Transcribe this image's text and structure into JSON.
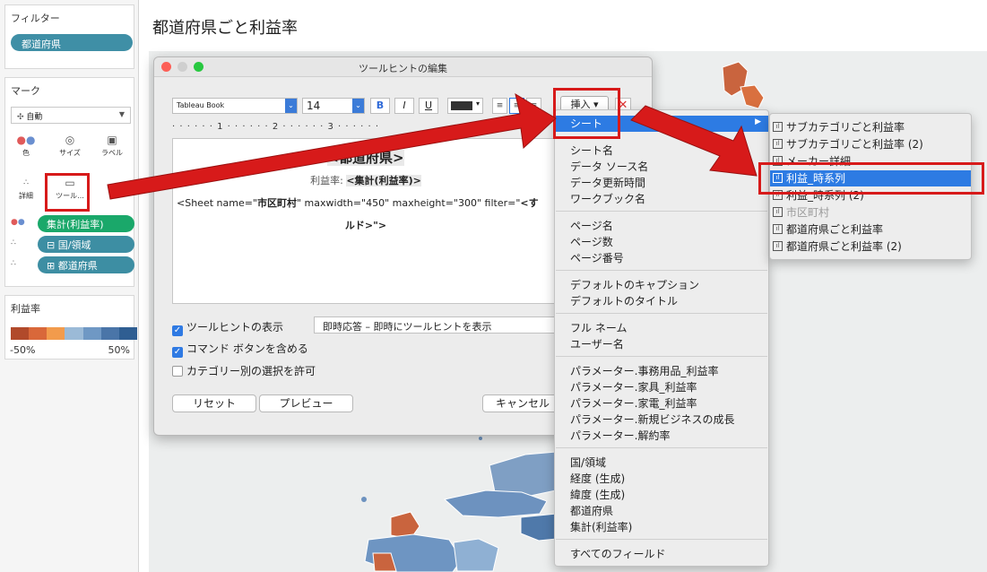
{
  "sidebar": {
    "filters": {
      "title": "フィルター",
      "pill": "都道府県"
    },
    "marks": {
      "title": "マーク",
      "mark_type": "自動",
      "buttons": {
        "color": "色",
        "size": "サイズ",
        "label": "ラベル",
        "detail": "詳細",
        "tooltip": "ツール..."
      },
      "pills": [
        {
          "text": "集計(利益率)",
          "color": "#1aa86a"
        },
        {
          "text": "⊟ 国/領域",
          "color": "#3d8ea3"
        },
        {
          "text": "⊞ 都道府県",
          "color": "#3d8ea3"
        }
      ]
    },
    "legend": {
      "title": "利益率",
      "min_label": "-50%",
      "max_label": "50%",
      "colors": [
        "#b14a2b",
        "#d9683a",
        "#f29b4c",
        "#9bbad7",
        "#6f98c4",
        "#4a75a8",
        "#2f5e92"
      ]
    }
  },
  "worksheet": {
    "title": "都道府県ごと利益率"
  },
  "dialog": {
    "title": "ツールヒントの編集",
    "font": "Tableau Book",
    "size": "14",
    "bold": "B",
    "italic": "I",
    "underline": "U",
    "insert_label": "挿入 ▾",
    "clear": "✕",
    "ruler": "· · · · · · 1 · · · · · · 2 · · · · · · 3 · · · · · ·",
    "editor": {
      "line1": "<都道府県>",
      "line2_label": "利益率: ",
      "line2_token": "<集計(利益率)>",
      "line3_pre": "<Sheet name=\"",
      "line3_name": "市区町村",
      "line3_mid": "\" maxwidth=\"450\" maxheight=\"300\" filter=\"",
      "line3_tail": "<す",
      "line4": "ルド>\">"
    },
    "show_tooltip": "ツールヒントの表示",
    "show_tooltip_mode": "即時応答 – 即時にツールヒントを表示",
    "include_command_buttons": "コマンド ボタンを含める",
    "allow_category_selection": "カテゴリー別の選択を許可",
    "reset": "リセット",
    "preview": "プレビュー",
    "cancel": "キャンセル"
  },
  "insert_menu": {
    "sheet": "シート",
    "groups": [
      [
        "シート名",
        "データ ソース名",
        "データ更新時間",
        "ワークブック名"
      ],
      [
        "ページ名",
        "ページ数",
        "ページ番号"
      ],
      [
        "デフォルトのキャプション",
        "デフォルトのタイトル"
      ],
      [
        "フル ネーム",
        "ユーザー名"
      ],
      [
        "パラメーター.事務用品_利益率",
        "パラメーター.家具_利益率",
        "パラメーター.家電_利益率",
        "パラメーター.新規ビジネスの成長",
        "パラメーター.解約率"
      ],
      [
        "国/領域",
        "経度 (生成)",
        "緯度 (生成)",
        "都道府県",
        "集計(利益率)"
      ],
      [
        "すべてのフィールド"
      ]
    ]
  },
  "sheet_menu": {
    "items": [
      "サブカテゴリごと利益率",
      "サブカテゴリごと利益率 (2)",
      "メーカー詳細",
      "利益_時系列",
      "利益_時系列 (2)",
      "市区町村",
      "都道府県ごと利益率",
      "都道府県ごと利益率 (2)"
    ]
  },
  "colors": {
    "accent": "#2d7be3",
    "callout": "#d71a1a",
    "pill": "#3d8ea3",
    "measure_pill": "#1aa86a"
  }
}
